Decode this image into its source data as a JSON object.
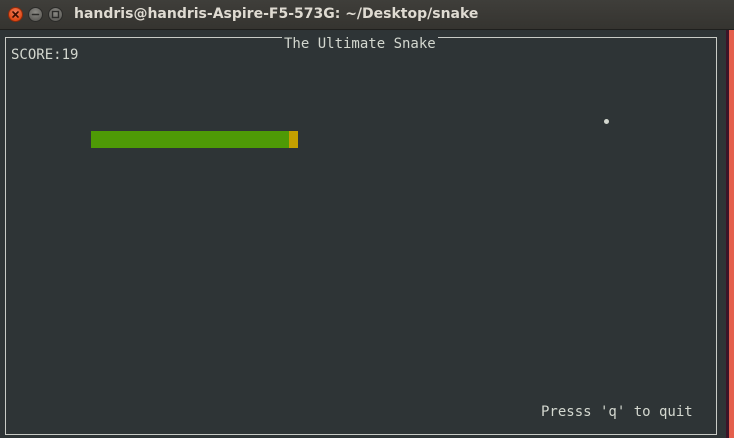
{
  "window": {
    "title": "handris@handris-Aspire-F5-573G: ~/Desktop/snake"
  },
  "game": {
    "title": "The Ultimate Snake",
    "score_text": "SCORE:19",
    "quit_hint": "Presss 'q' to quit"
  },
  "colors": {
    "snake_body": "#4e9a06",
    "snake_head": "#c4a000",
    "food": "#d3d7cf",
    "terminal_bg": "#2e3436"
  },
  "icons": {
    "close": "close-icon",
    "minimize": "minimize-icon",
    "maximize": "maximize-icon"
  }
}
